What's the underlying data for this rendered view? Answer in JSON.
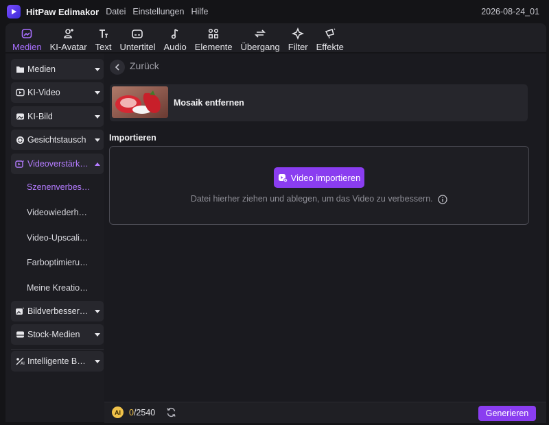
{
  "app": {
    "title": "HitPaw Edimakor",
    "menu": [
      "Datei",
      "Einstellungen",
      "Hilfe"
    ],
    "project_name": "2026-08-24_01"
  },
  "toolbar": {
    "tabs": [
      {
        "label": "Medien",
        "icon": "media-icon",
        "active": true
      },
      {
        "label": "KI-Avatar",
        "icon": "avatar-icon",
        "active": false
      },
      {
        "label": "Text",
        "icon": "text-icon",
        "active": false
      },
      {
        "label": "Untertitel",
        "icon": "subtitle-icon",
        "active": false
      },
      {
        "label": "Audio",
        "icon": "audio-icon",
        "active": false
      },
      {
        "label": "Elemente",
        "icon": "elements-icon",
        "active": false
      },
      {
        "label": "Übergang",
        "icon": "transition-icon",
        "active": false
      },
      {
        "label": "Filter",
        "icon": "filter-icon",
        "active": false
      },
      {
        "label": "Effekte",
        "icon": "effects-icon",
        "active": false
      }
    ]
  },
  "sidebar": {
    "items": [
      {
        "label": "Medien",
        "icon": "folder-icon"
      },
      {
        "label": "KI-Video",
        "icon": "ai-video-icon"
      },
      {
        "label": "KI-Bild",
        "icon": "ai-image-icon"
      },
      {
        "label": "Gesichtstausch",
        "icon": "face-swap-icon"
      },
      {
        "label": "Videoverstärk…",
        "icon": "video-enhance-icon",
        "expanded": true
      },
      {
        "label": "Bildverbesser…",
        "icon": "image-enhance-icon"
      },
      {
        "label": "Stock-Medien",
        "icon": "stock-media-icon"
      },
      {
        "label": "Intelligente B…",
        "icon": "smart-tools-icon"
      }
    ],
    "subitems": [
      {
        "label": "Szenenverbes…",
        "active": true
      },
      {
        "label": "Videowiederh…",
        "active": false
      },
      {
        "label": "Video-Upscali…",
        "active": false
      },
      {
        "label": "Farboptimieru…",
        "active": false
      },
      {
        "label": "Meine Kreatio…",
        "active": false
      }
    ]
  },
  "main": {
    "back_label": "Zurück",
    "card": {
      "title": "Mosaik entfernen",
      "thumb": "strawberry-thumbnail"
    },
    "section_label": "Importieren",
    "import_button": "Video importieren",
    "drop_hint": "Datei hierher ziehen und ablegen, um das Video zu verbessern."
  },
  "bottom": {
    "ai_badge": "AI",
    "credits_used": "0",
    "credits_total": "/2540",
    "generate_label": "Generieren"
  },
  "colors": {
    "accent": "#8a3df0",
    "active_text": "#b47cff",
    "background": "#141417",
    "coin": "#f0c24a"
  }
}
